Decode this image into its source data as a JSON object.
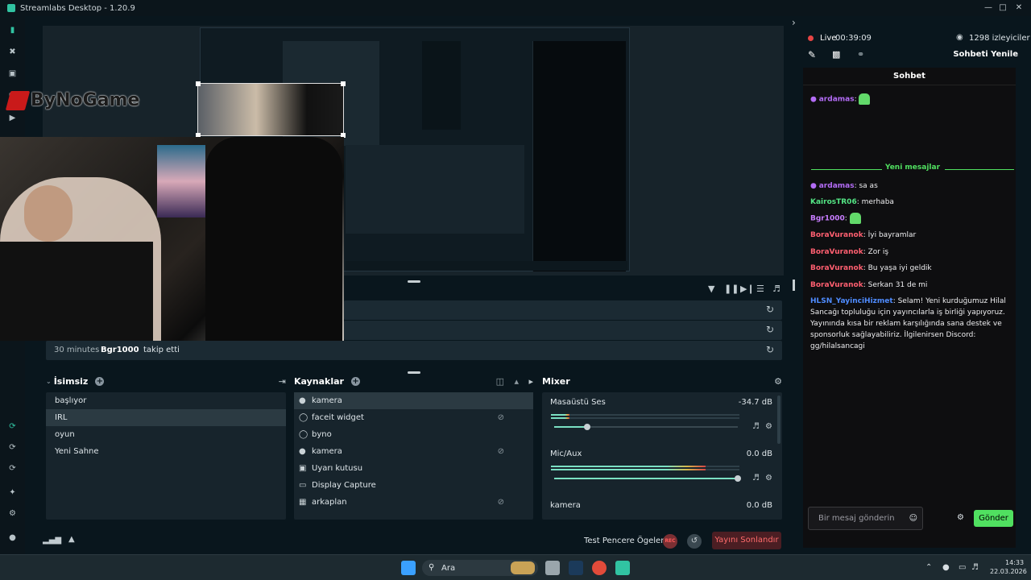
{
  "window": {
    "title": "Streamlabs Desktop - 1.20.9"
  },
  "preview": {
    "logo_text": "ByNoGame"
  },
  "events": [
    {
      "time": "",
      "user": "",
      "action": ""
    },
    {
      "time": "",
      "user": "",
      "action": ""
    },
    {
      "time": "30 minutes",
      "user": "Bgr1000",
      "action": "takip etti"
    }
  ],
  "scenes": {
    "header": "İsimsiz",
    "items": [
      "başlıyor",
      "IRL",
      "oyun",
      "Yeni Sahne"
    ],
    "selected": "IRL"
  },
  "sources": {
    "header": "Kaynaklar",
    "items": [
      {
        "name": "kamera",
        "icon": "camera-icon",
        "hidden": false
      },
      {
        "name": "faceit widget",
        "icon": "globe-icon",
        "hidden": true
      },
      {
        "name": "byno",
        "icon": "globe-icon",
        "hidden": false
      },
      {
        "name": "kamera",
        "icon": "camera-icon",
        "hidden": true
      },
      {
        "name": "Uyarı kutusu",
        "icon": "alert-box-icon",
        "hidden": false
      },
      {
        "name": "Display Capture",
        "icon": "monitor-icon",
        "hidden": false
      },
      {
        "name": "arkaplan",
        "icon": "image-icon",
        "hidden": true
      }
    ]
  },
  "mixer": {
    "header": "Mixer",
    "channels": [
      {
        "name": "Masaüstü Ses",
        "db": "-34.7 dB",
        "level": 0.1,
        "volume": 0.18
      },
      {
        "name": "Mic/Aux",
        "db": "0.0 dB",
        "level": 0.82,
        "volume": 1.0
      },
      {
        "name": "kamera",
        "db": "0.0 dB",
        "level": 0,
        "volume": 1.0
      }
    ]
  },
  "footer": {
    "test_label": "Test Pencere Ögeleri",
    "rec_label": "REC",
    "end_label": "Yayını Sonlandır"
  },
  "live": {
    "status": "Live",
    "time": "00:39:09",
    "viewers": "1298 izleyiciler",
    "refresh_label": "Sohbeti Yenile"
  },
  "chat": {
    "title": "Sohbet",
    "new_messages": "Yeni mesajlar",
    "messages": [
      {
        "user": "ardamas",
        "text": "",
        "color": "#b36cf5",
        "emote": true,
        "mic": true
      },
      {
        "user": "ardamas",
        "text": "sa as",
        "color": "#b36cf5",
        "emote": false,
        "mic": true
      },
      {
        "user": "KairosTR06",
        "text": "merhaba",
        "color": "#54e685",
        "emote": false,
        "mic": false
      },
      {
        "user": "Bgr1000",
        "text": "",
        "color": "#c87dff",
        "emote": true,
        "mic": false
      },
      {
        "user": "BoraVuranok",
        "text": "İyi bayramlar",
        "color": "#ff5f70",
        "emote": false,
        "mic": false
      },
      {
        "user": "BoraVuranok",
        "text": "Zor iş",
        "color": "#ff5f70",
        "emote": false,
        "mic": false
      },
      {
        "user": "BoraVuranok",
        "text": "Bu yaşa iyi geldik",
        "color": "#ff5f70",
        "emote": false,
        "mic": false
      },
      {
        "user": "BoraVuranok",
        "text": "Serkan 31 de mi",
        "color": "#ff5f70",
        "emote": false,
        "mic": false
      },
      {
        "user": "HLSN_YayinciHizmet",
        "text": "Selam! Yeni kurduğumuz Hilal Sancağı topluluğu için yayıncılarla iş birliği yapıyoruz. Yayınında kısa bir reklam karşılığında sana destek ve sponsorluk sağlayabiliriz. İlgilenirsen Discord: gg/hilalsancagi",
        "color": "#4f8cff",
        "emote": false,
        "mic": false
      }
    ],
    "input_placeholder": "Bir mesaj gönderin",
    "send_label": "Gönder"
  },
  "taskbar": {
    "search": "Ara",
    "time": "14:33",
    "date": "22.03.2026"
  },
  "colors": {
    "accent": "#31c3a2",
    "danger": "#ff6b6b",
    "chat_green": "#50e060"
  }
}
